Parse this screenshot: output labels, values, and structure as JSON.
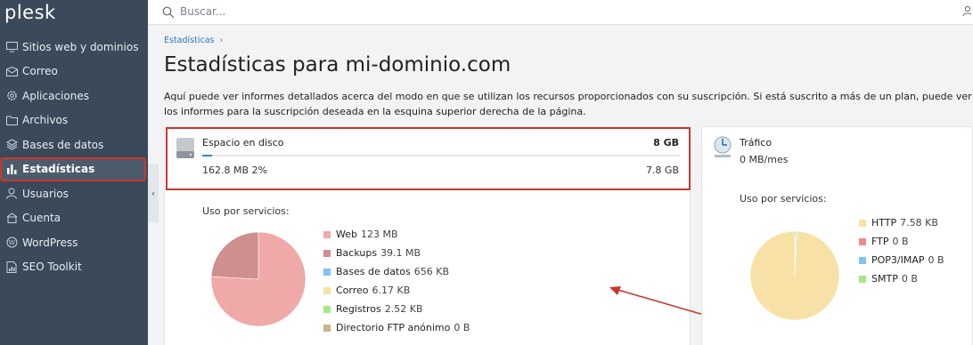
{
  "logo": "plesk",
  "sidebar": {
    "items": [
      {
        "label": "Sitios web y dominios",
        "icon": "monitor-icon"
      },
      {
        "label": "Correo",
        "icon": "mail-icon"
      },
      {
        "label": "Aplicaciones",
        "icon": "gear-icon"
      },
      {
        "label": "Archivos",
        "icon": "folder-icon"
      },
      {
        "label": "Bases de datos",
        "icon": "database-icon"
      },
      {
        "label": "Estadísticas",
        "icon": "bar-chart-icon",
        "active": true
      },
      {
        "label": "Usuarios",
        "icon": "user-icon"
      },
      {
        "label": "Cuenta",
        "icon": "account-icon"
      },
      {
        "label": "WordPress",
        "icon": "wordpress-icon"
      },
      {
        "label": "SEO Toolkit",
        "icon": "seo-icon"
      }
    ]
  },
  "search": {
    "placeholder": "Buscar..."
  },
  "breadcrumb": {
    "item": "Estadísticas"
  },
  "page": {
    "title": "Estadísticas para mi-dominio.com",
    "description": "Aquí puede ver informes detallados acerca del modo en que se utilizan los recursos proporcionados con su suscripción. Si está suscrito a más de un plan, puede ver los informes para la suscripción deseada en la esquina superior derecha de la página."
  },
  "disk": {
    "title": "Espacio en disco",
    "total": "8 GB",
    "used": "162.8 MB 2%",
    "free": "7.8 GB",
    "used_fraction": 0.02,
    "usage_label": "Uso por servicios:",
    "services": [
      {
        "name": "Web",
        "value": "123 MB",
        "mb": 123,
        "color": "#f0a9a9"
      },
      {
        "name": "Backups",
        "value": "39.1 MB",
        "mb": 39.1,
        "color": "#d08f8f"
      },
      {
        "name": "Bases de datos",
        "value": "656 KB",
        "mb": 0.64,
        "color": "#7ec4f0"
      },
      {
        "name": "Correo",
        "value": "6.17 KB",
        "mb": 0.006,
        "color": "#f7e1a6"
      },
      {
        "name": "Registros",
        "value": "2.52 KB",
        "mb": 0.0025,
        "color": "#a6e88a"
      },
      {
        "name": "Directorio FTP anónimo",
        "value": "0 B",
        "mb": 0,
        "color": "#c9b48a"
      }
    ]
  },
  "traffic": {
    "title": "Tráfico",
    "value": "0 MB/mes",
    "usage_label": "Uso por servicios:",
    "services": [
      {
        "name": "HTTP",
        "value": "7.58 KB",
        "color": "#f7e1a6"
      },
      {
        "name": "FTP",
        "value": "0 B",
        "color": "#f08a8a"
      },
      {
        "name": "POP3/IMAP",
        "value": "0 B",
        "color": "#7ec4f0"
      },
      {
        "name": "SMTP",
        "value": "0 B",
        "color": "#a6e88a"
      }
    ]
  }
}
